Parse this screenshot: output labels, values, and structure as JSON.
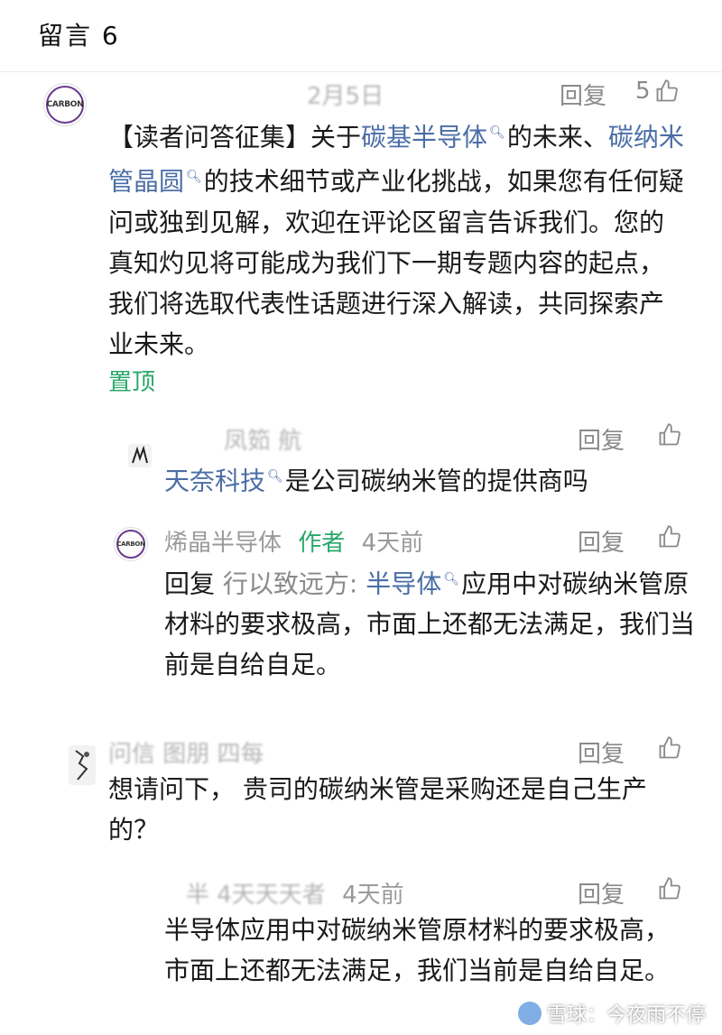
{
  "header": {
    "title": "留言 6"
  },
  "comments": [
    {
      "meta": "2月5日",
      "reply_label": "回复",
      "likes": "5",
      "segments": {
        "s1": "【读者问答征集】关于",
        "link1": "碳基半导体",
        "s2": "的未来、",
        "link2": "碳纳米管晶圆",
        "s3": "的技术细节或产业化挑战，如果您有任何疑问或独到见解，欢迎在评论区留言告诉我们。您的真知灼见将可能成为我们下一期专题内容的起点，我们将选取代表性话题进行深入解读，共同探索产业未来。"
      },
      "pinned": "置顶"
    },
    {
      "meta": "凤筎 航",
      "reply_label": "回复",
      "link": "天奈科技",
      "text": "是公司碳纳米管的提供商吗"
    },
    {
      "name": "烯晶半导体",
      "author_tag": "作者",
      "time": "4天前",
      "reply_label": "回复",
      "prefix": "回复",
      "quote": "行以致远方:",
      "link": "半导体",
      "text": "应用中对碳纳米管原材料的要求极高，市面上还都无法满足，我们当前是自给自足。"
    },
    {
      "meta": "问信 图朋 四每",
      "reply_label": "回复",
      "text": "想请问下，  贵司的碳纳米管是采购还是自己生产的？"
    },
    {
      "meta": "半 4天天天者",
      "time": "4天前",
      "reply_label": "回复",
      "text": "半导体应用中对碳纳米管原材料的要求极高，市面上还都无法满足，我们当前是自给自足。"
    }
  ],
  "avatar_label": "CARBON",
  "watermark": "雪球：今夜雨不停"
}
